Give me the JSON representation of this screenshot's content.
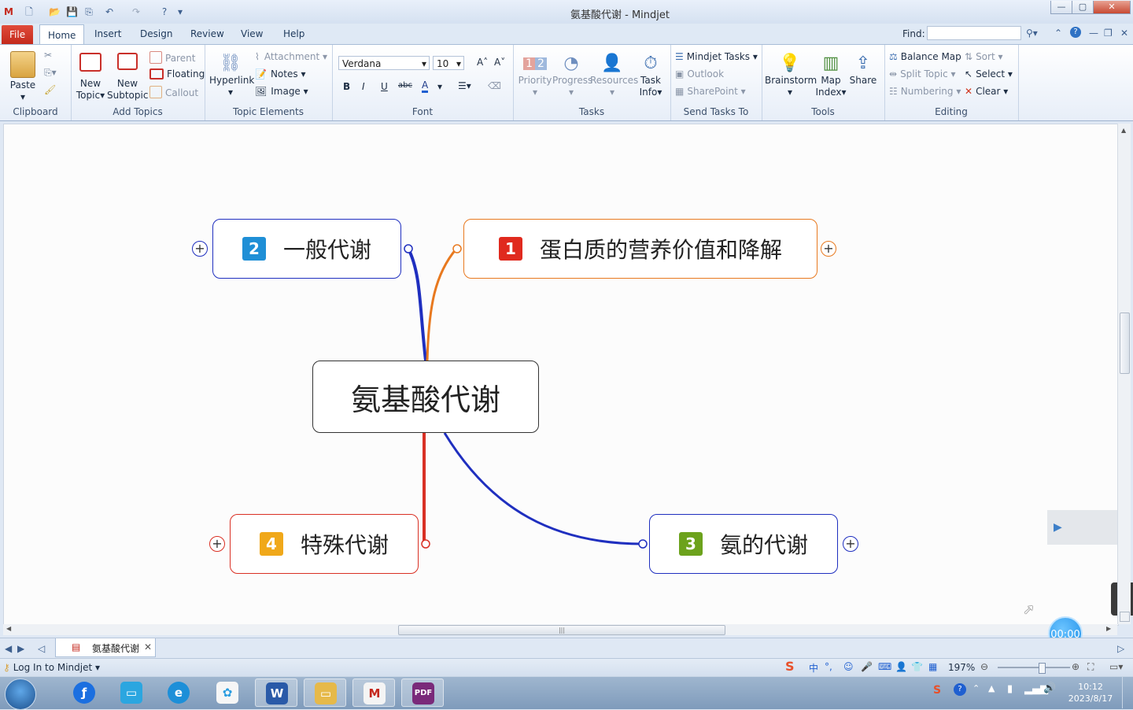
{
  "window": {
    "title": "氨基酸代谢 - Mindjet",
    "controls": [
      "—",
      "▢",
      "✕"
    ]
  },
  "tabs": [
    "File",
    "Home",
    "Insert",
    "Design",
    "Review",
    "View",
    "Help"
  ],
  "find": {
    "label": "Find:"
  },
  "ribbon": {
    "clipboard": {
      "label": "Clipboard",
      "paste": "Paste"
    },
    "add_topics": {
      "label": "Add Topics",
      "new_topic_1": "New",
      "new_topic_2": "Topic",
      "new_subtopic_1": "New",
      "new_subtopic_2": "Subtopic",
      "parent": "Parent",
      "floating": "Floating",
      "callout": "Callout"
    },
    "topic_elements": {
      "label": "Topic Elements",
      "hyperlink": "Hyperlink",
      "attachment": "Attachment",
      "notes": "Notes",
      "image": "Image"
    },
    "font": {
      "label": "Font",
      "family": "Verdana",
      "size": "10"
    },
    "tasks": {
      "label": "Tasks",
      "priority": "Priority",
      "progress": "Progress",
      "resources": "Resources",
      "task_info_1": "Task",
      "task_info_2": "Info"
    },
    "send_tasks": {
      "label": "Send Tasks To",
      "mindjet_tasks": "Mindjet Tasks",
      "outlook": "Outlook",
      "sharepoint": "SharePoint"
    },
    "tools": {
      "label": "Tools",
      "brainstorm": "Brainstorm",
      "map_index_1": "Map",
      "map_index_2": "Index",
      "share": "Share"
    },
    "editing": {
      "label": "Editing",
      "balance_map": "Balance Map",
      "split_topic": "Split Topic",
      "numbering": "Numbering",
      "sort": "Sort",
      "select": "Select",
      "clear": "Clear"
    }
  },
  "map": {
    "central": "氨基酸代谢",
    "topics": [
      {
        "num": "1",
        "text": "蛋白质的营养价值和降解",
        "color": "#e8791f",
        "badge": "#e02a1e"
      },
      {
        "num": "2",
        "text": "一般代谢",
        "color": "#1f2fbf",
        "badge": "#1f8fd6"
      },
      {
        "num": "3",
        "text": "氨的代谢",
        "color": "#1f2fbf",
        "badge": "#6ca21c"
      },
      {
        "num": "4",
        "text": "特殊代谢",
        "color": "#d93024",
        "badge": "#f0a81a"
      }
    ]
  },
  "doc_tab": {
    "name": "氨基酸代谢"
  },
  "status": {
    "login": "Log In to Mindjet",
    "zoom": "197%",
    "timer": "00:00",
    "time": "10:12",
    "date": "2023/8/17",
    "ime_chars": "中"
  }
}
